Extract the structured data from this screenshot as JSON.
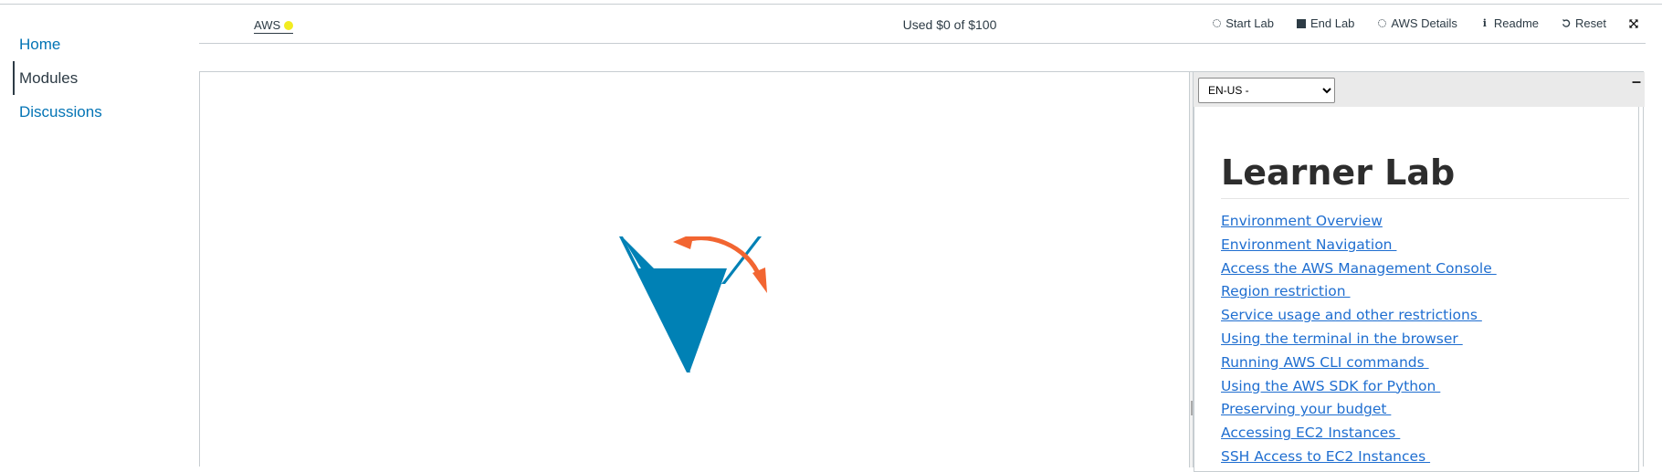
{
  "nav": {
    "items": [
      {
        "label": "Home",
        "active": false
      },
      {
        "label": "Modules",
        "active": true
      },
      {
        "label": "Discussions",
        "active": false
      }
    ]
  },
  "toolbar": {
    "aws_label": "AWS",
    "status_color": "#f2ec21",
    "budget": "Used $0 of $100",
    "actions": {
      "start_lab": "Start Lab",
      "end_lab": "End Lab",
      "aws_details": "AWS Details",
      "readme": "Readme",
      "reset": "Reset"
    }
  },
  "readme": {
    "language": "EN-US -",
    "title": "Learner Lab",
    "toc": [
      "Environment Overview",
      "Environment Navigation ",
      "Access the AWS Management Console ",
      "Region restriction ",
      "Service usage and other restrictions ",
      "Using the terminal in the browser ",
      "Running AWS CLI commands ",
      "Using the AWS SDK for Python ",
      "Preserving your budget ",
      "Accessing EC2 Instances ",
      "SSH Access to EC2 Instances "
    ]
  },
  "colors": {
    "link": "#0374b5",
    "readme_link": "#1f6ed0",
    "logo_blue": "#0081b5",
    "logo_orange": "#f26531"
  }
}
